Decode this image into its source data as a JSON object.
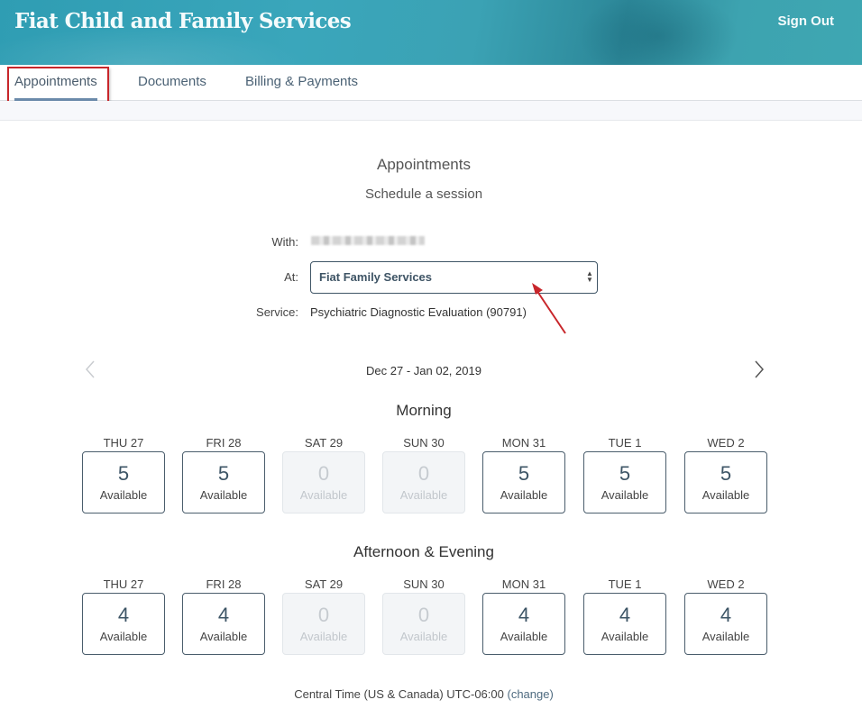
{
  "header": {
    "brand": "Fiat Child and Family Services",
    "sign_out": "Sign Out"
  },
  "tabs": [
    {
      "label": "Appointments",
      "active": true
    },
    {
      "label": "Documents",
      "active": false
    },
    {
      "label": "Billing & Payments",
      "active": false
    }
  ],
  "page": {
    "title": "Appointments",
    "subtitle": "Schedule a session"
  },
  "form": {
    "with_label": "With:",
    "with_value": "(redacted name)",
    "at_label": "At:",
    "at_value": "Fiat Family Services",
    "service_label": "Service:",
    "service_value": "Psychiatric Diagnostic Evaluation (90791)"
  },
  "calendar": {
    "date_range": "Dec 27 - Jan 02, 2019",
    "prev_icon": "chevron-left-icon",
    "next_icon": "chevron-right-icon",
    "available_label": "Available",
    "sections": [
      {
        "title": "Morning",
        "days": [
          {
            "label": "THU 27",
            "count": "5",
            "disabled": false
          },
          {
            "label": "FRI 28",
            "count": "5",
            "disabled": false
          },
          {
            "label": "SAT 29",
            "count": "0",
            "disabled": true
          },
          {
            "label": "SUN 30",
            "count": "0",
            "disabled": true
          },
          {
            "label": "MON 31",
            "count": "5",
            "disabled": false
          },
          {
            "label": "TUE 1",
            "count": "5",
            "disabled": false
          },
          {
            "label": "WED 2",
            "count": "5",
            "disabled": false
          }
        ]
      },
      {
        "title": "Afternoon & Evening",
        "days": [
          {
            "label": "THU 27",
            "count": "4",
            "disabled": false
          },
          {
            "label": "FRI 28",
            "count": "4",
            "disabled": false
          },
          {
            "label": "SAT 29",
            "count": "0",
            "disabled": true
          },
          {
            "label": "SUN 30",
            "count": "0",
            "disabled": true
          },
          {
            "label": "MON 31",
            "count": "4",
            "disabled": false
          },
          {
            "label": "TUE 1",
            "count": "4",
            "disabled": false
          },
          {
            "label": "WED 2",
            "count": "4",
            "disabled": false
          }
        ]
      }
    ]
  },
  "timezone": {
    "text": "Central Time (US & Canada) UTC-06:00",
    "change_link": "(change)"
  },
  "colors": {
    "header_bg": "#3aa6bb",
    "accent": "#3e5465",
    "highlight": "#c8262b"
  }
}
